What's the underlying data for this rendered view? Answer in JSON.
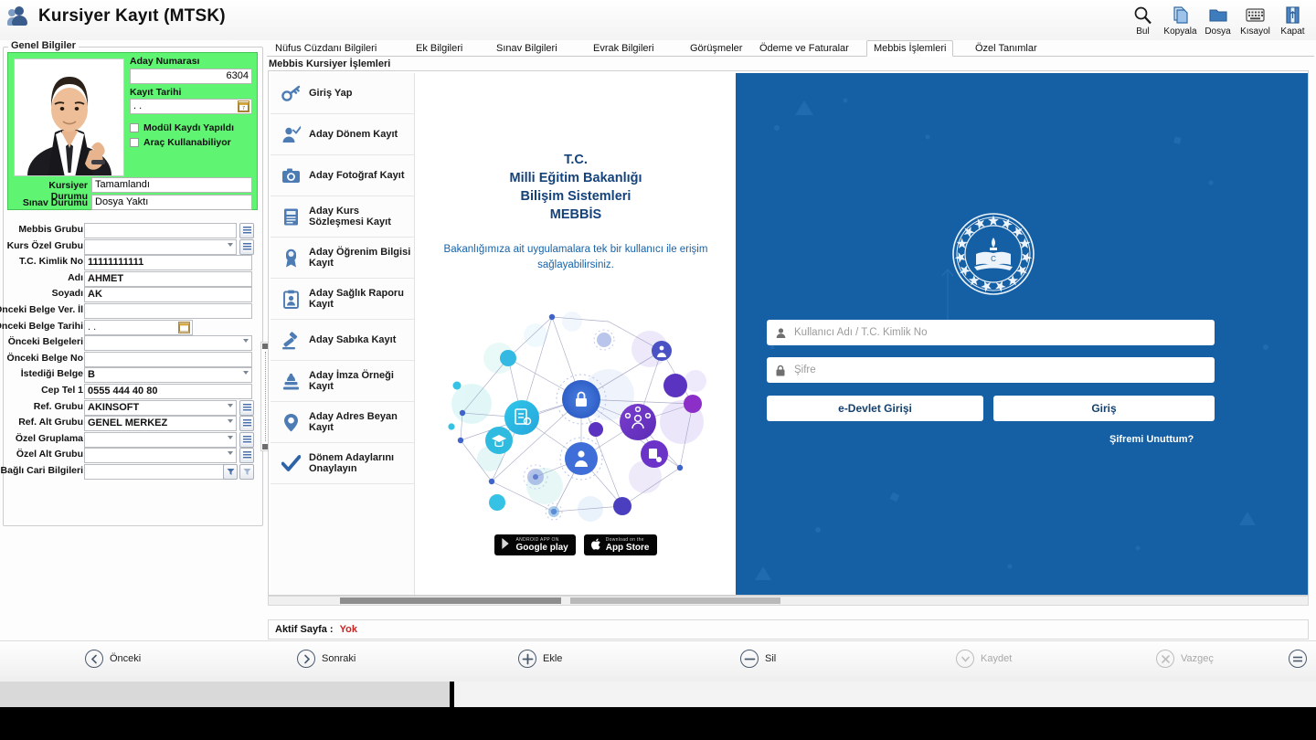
{
  "window": {
    "title": "Kursiyer Kayıt (MTSK)",
    "icon": "users-icon"
  },
  "toolbar": {
    "buttons": [
      {
        "label": "Bul",
        "icon": "search-icon"
      },
      {
        "label": "Kopyala",
        "icon": "copy-icon"
      },
      {
        "label": "Dosya",
        "icon": "folder-icon"
      },
      {
        "label": "Kısayol",
        "icon": "keyboard-icon"
      },
      {
        "label": "Kapat",
        "icon": "exit-door-icon"
      }
    ]
  },
  "general": {
    "group_label": "Genel Bilgiler",
    "aday_numarasi_label": "Aday Numarası",
    "aday_numarasi_value": "6304",
    "kayit_tarihi_label": "Kayıt Tarihi",
    "kayit_tarihi_value": ". .",
    "modul_kaydi_label": "Modül Kaydı Yapıldı",
    "modul_kaydi_checked": false,
    "arac_kullanabiliyor_label": "Araç Kullanabiliyor",
    "arac_kullanabiliyor_checked": false,
    "kursiyer_durumu_label": "Kursiyer Durumu",
    "kursiyer_durumu_value": "Tamamlandı",
    "sinav_durumu_label": "Sınav Durumu",
    "sinav_durumu_value": "Dosya Yaktı",
    "green_bg": "#5ff472"
  },
  "form_fields": [
    {
      "label": "Mebbis Grubu",
      "value": "",
      "type": "text-lister"
    },
    {
      "label": "Kurs Özel Grubu",
      "value": "",
      "type": "combo-lister"
    },
    {
      "label": "T.C. Kimlik No",
      "value": "11111111111",
      "type": "text"
    },
    {
      "label": "Adı",
      "value": "AHMET",
      "type": "text"
    },
    {
      "label": "Soyadı",
      "value": "AK",
      "type": "text"
    },
    {
      "label": "Önceki Belge Ver. İl",
      "value": "",
      "type": "text"
    },
    {
      "label": "Önceki Belge Tarihi",
      "value": ". .",
      "type": "date"
    },
    {
      "label": "Önceki Belgeleri",
      "value": "",
      "type": "combo"
    },
    {
      "label": "Önceki Belge No",
      "value": "",
      "type": "text"
    },
    {
      "label": "İstediği Belge",
      "value": "B",
      "type": "combo"
    },
    {
      "label": "Cep Tel 1",
      "value": "0555 444 40 80",
      "type": "text"
    },
    {
      "label": "Ref. Grubu",
      "value": "AKINSOFT",
      "type": "combo-lister"
    },
    {
      "label": "Ref. Alt Grubu",
      "value": "GENEL MERKEZ",
      "type": "combo-lister"
    },
    {
      "label": "Özel Gruplama",
      "value": "",
      "type": "combo-lister"
    },
    {
      "label": "Özel Alt Grubu",
      "value": "",
      "type": "combo-lister"
    },
    {
      "label": "Bağlı Cari Bilgileri",
      "value": "",
      "type": "text-filter"
    }
  ],
  "tabs": [
    {
      "label": "Nüfus Cüzdanı Bilgileri",
      "active": false
    },
    {
      "label": "Ek Bilgileri",
      "active": false
    },
    {
      "label": "Sınav Bilgileri",
      "active": false
    },
    {
      "label": "Evrak Bilgileri",
      "active": false
    },
    {
      "label": "Görüşmeler",
      "active": false
    },
    {
      "label": "Ödeme ve Faturalar",
      "active": false
    },
    {
      "label": "Mebbis İşlemleri",
      "active": true
    },
    {
      "label": "Özel Tanımlar",
      "active": false
    }
  ],
  "panel": {
    "subheader": "Mebbis Kursiyer İşlemleri"
  },
  "menu_items": [
    {
      "label": "Giriş Yap",
      "icon": "key-icon"
    },
    {
      "label": "Aday Dönem Kayıt",
      "icon": "user-check-icon"
    },
    {
      "label": "Aday Fotoğraf Kayıt",
      "icon": "camera-icon"
    },
    {
      "label": "Aday Kurs Sözleşmesi Kayıt",
      "icon": "document-icon"
    },
    {
      "label": "Aday Öğrenim Bilgisi Kayıt",
      "icon": "award-icon"
    },
    {
      "label": "Aday Sağlık Raporu Kayıt",
      "icon": "clipboard-person-icon"
    },
    {
      "label": "Aday Sabıka Kayıt",
      "icon": "gavel-icon"
    },
    {
      "label": "Aday İmza Örneği Kayıt",
      "icon": "stamp-icon"
    },
    {
      "label": "Aday Adres Beyan Kayıt",
      "icon": "map-pin-icon"
    },
    {
      "label": "Dönem Adaylarını Onaylayın",
      "icon": "checkmark-icon"
    }
  ],
  "mebbis": {
    "heading_lines": [
      "T.C.",
      "Milli Eğitim Bakanlığı",
      "Bilişim Sistemleri",
      "MEBBİS"
    ],
    "description": "Bakanlığımıza ait uygulamalara tek bir kullanıcı ile erişim sağlayabilirsiniz.",
    "illustration": "network-nodes-illustration",
    "badges": [
      {
        "small": "ANDROID APP ON",
        "big": "Google play",
        "icon": "google-play-icon"
      },
      {
        "small": "Download on the",
        "big": "App Store",
        "icon": "apple-icon"
      }
    ],
    "login": {
      "logo": "meb-seal-logo",
      "username_placeholder": "Kullanıcı Adı / T.C. Kimlik No",
      "username_value": "",
      "username_icon": "user-icon",
      "password_placeholder": "Şifre",
      "password_value": "",
      "password_icon": "lock-icon",
      "edevlet_button": "e-Devlet Girişi",
      "login_button": "Giriş",
      "forgot_link": "Şifremi Unuttum?",
      "panel_color": "#1560a5"
    }
  },
  "status": {
    "label": "Aktif Sayfa :",
    "value": "Yok",
    "value_color": "#cc2222"
  },
  "commands": [
    {
      "label": "Önceki",
      "icon": "chevron-left-circle-icon",
      "disabled": false
    },
    {
      "label": "Sonraki",
      "icon": "chevron-right-circle-icon",
      "disabled": false
    },
    {
      "label": "Ekle",
      "icon": "plus-circle-icon",
      "disabled": false
    },
    {
      "label": "Sil",
      "icon": "minus-circle-icon",
      "disabled": false
    },
    {
      "label": "Kaydet",
      "icon": "chevron-down-circle-icon",
      "disabled": true
    },
    {
      "label": "Vazgeç",
      "icon": "x-circle-icon",
      "disabled": true
    }
  ],
  "overflow_menu": {
    "icon": "menu-circle-icon"
  }
}
